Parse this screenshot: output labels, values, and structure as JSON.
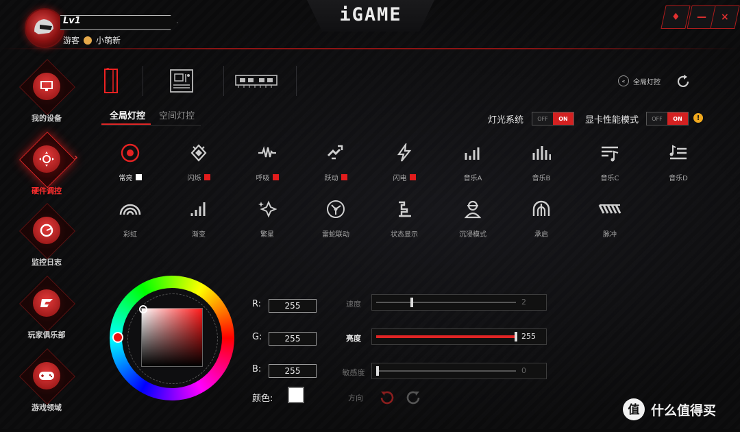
{
  "app": {
    "logo": "iGAME"
  },
  "user": {
    "level": "Lv1",
    "role": "游客",
    "name": "小萌新"
  },
  "window_controls": [
    {
      "name": "skin-button",
      "glyph": "♦"
    },
    {
      "name": "minimize-button",
      "glyph": "—"
    },
    {
      "name": "close-button",
      "glyph": "×"
    }
  ],
  "nav": [
    {
      "label": "我的设备",
      "icon": "monitor-icon",
      "active": false
    },
    {
      "label": "硬件调控",
      "icon": "gamepad-dpad-icon",
      "active": true
    },
    {
      "label": "监控日志",
      "icon": "gauge-icon",
      "active": false
    },
    {
      "label": "玩家俱乐部",
      "icon": "igame-club-icon",
      "active": false
    },
    {
      "label": "游戏领域",
      "icon": "controller-icon",
      "active": false
    }
  ],
  "device_tabs": [
    {
      "icon": "pc-case-icon",
      "active": true
    },
    {
      "icon": "motherboard-icon",
      "active": false
    },
    {
      "icon": "memory-icon",
      "active": false
    }
  ],
  "header_right": {
    "global_label": "全局灯控"
  },
  "mode_tabs": {
    "global": "全局灯控",
    "space": "空间灯控"
  },
  "toggles": {
    "light_system": {
      "label": "灯光系统",
      "off": "OFF",
      "on": "ON"
    },
    "gpu_perf": {
      "label": "显卡性能模式",
      "off": "OFF",
      "on": "ON"
    }
  },
  "effects_row1": [
    {
      "label": "常亮",
      "icon": "target-icon",
      "swatch": "white",
      "active": true
    },
    {
      "label": "闪烁",
      "icon": "flash-star-icon",
      "swatch": "red",
      "active": false
    },
    {
      "label": "呼吸",
      "icon": "pulse-wave-icon",
      "swatch": "red",
      "active": false
    },
    {
      "label": "跃动",
      "icon": "jump-icon",
      "swatch": "red",
      "active": false
    },
    {
      "label": "闪电",
      "icon": "lightning-icon",
      "swatch": "red",
      "active": false
    },
    {
      "label": "音乐A",
      "icon": "bars-a-icon",
      "swatch": "",
      "active": false
    },
    {
      "label": "音乐B",
      "icon": "bars-b-icon",
      "swatch": "",
      "active": false
    },
    {
      "label": "音乐C",
      "icon": "music-c-icon",
      "swatch": "",
      "active": false
    },
    {
      "label": "音乐D",
      "icon": "music-d-icon",
      "swatch": "",
      "active": false
    }
  ],
  "effects_row2": [
    {
      "label": "彩虹",
      "icon": "rainbow-icon"
    },
    {
      "label": "渐变",
      "icon": "gradient-bars-icon"
    },
    {
      "label": "繁星",
      "icon": "stars-icon"
    },
    {
      "label": "雷蛇联动",
      "icon": "razer-icon"
    },
    {
      "label": "状态显示",
      "icon": "status-icon"
    },
    {
      "label": "沉浸模式",
      "icon": "immersive-icon"
    },
    {
      "label": "承启",
      "icon": "arch-icon"
    },
    {
      "label": "脉冲",
      "icon": "pulse-icon"
    }
  ],
  "rgb": {
    "r_label": "R:",
    "g_label": "G:",
    "b_label": "B:",
    "r": "255",
    "g": "255",
    "b": "255",
    "color_label": "颜色:"
  },
  "sliders": {
    "speed": {
      "label": "速度",
      "value": "2",
      "fraction": 0.25
    },
    "brightness": {
      "label": "亮度",
      "value": "255",
      "fraction": 1.0
    },
    "sensitivity": {
      "label": "敏感度",
      "value": "0",
      "fraction": 0.0
    }
  },
  "direction_label": "方向",
  "watermark": {
    "text": "什么值得买",
    "badge": "值"
  }
}
